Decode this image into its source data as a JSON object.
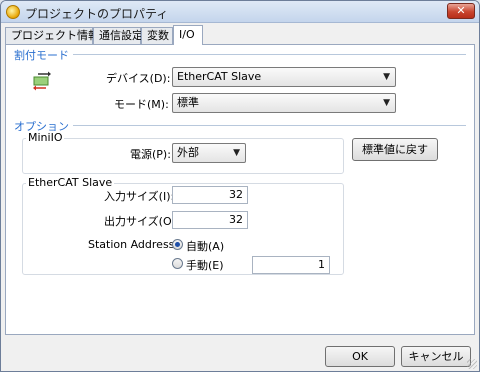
{
  "window": {
    "title": "プロジェクトのプロパティ",
    "close_glyph": "✕"
  },
  "tabs": [
    {
      "label": "プロジェクト情報",
      "active": false
    },
    {
      "label": "通信設定",
      "active": false
    },
    {
      "label": "変数",
      "active": false
    },
    {
      "label": "I/O",
      "active": true
    }
  ],
  "assignment": {
    "section_title": "割付モード",
    "device_label": "デバイス(D):",
    "device_value": "EtherCAT Slave",
    "mode_label": "モード(M):",
    "mode_value": "標準"
  },
  "options": {
    "section_title": "オプション",
    "minio": {
      "group_title": "MiniIO",
      "power_label": "電源(P):",
      "power_value": "外部"
    },
    "restore_default_label": "標準値に戻す",
    "ethercat": {
      "group_title": "EtherCAT Slave",
      "input_size_label": "入力サイズ(I):",
      "input_size_value": "32",
      "output_size_label": "出力サイズ(O):",
      "output_size_value": "32",
      "station_address_label": "Station Address :",
      "auto_label": "自動(A)",
      "manual_label": "手動(E)",
      "manual_value": "1",
      "selected": "auto"
    }
  },
  "footer": {
    "ok_label": "OK",
    "cancel_label": "キャンセル"
  },
  "colors": {
    "section_title": "#2a6fcf",
    "close_button": "#c9452f"
  }
}
